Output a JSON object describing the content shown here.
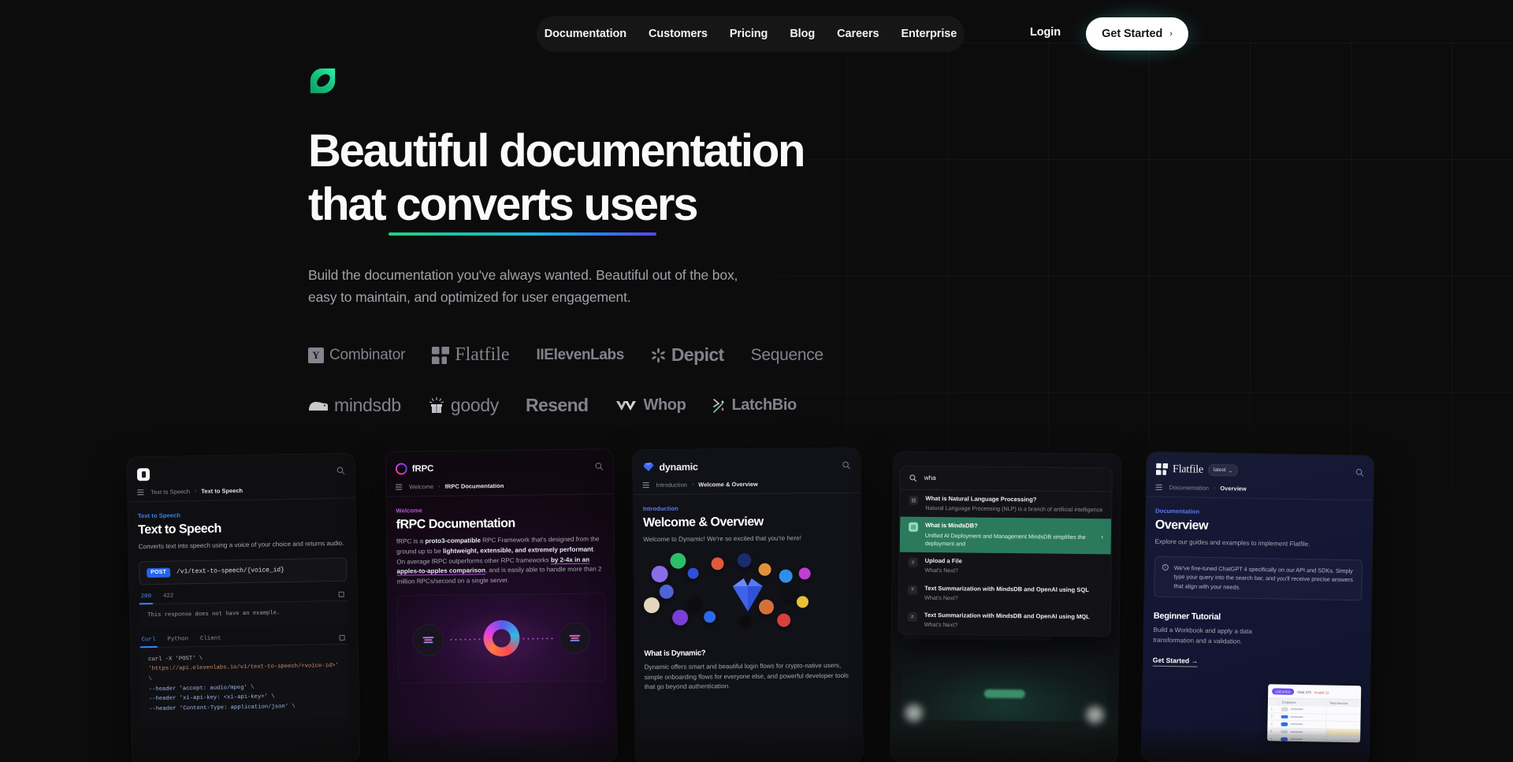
{
  "brand": {
    "logo_icon": "mintlify-leaf-logo"
  },
  "nav": {
    "items": [
      {
        "label": "Documentation"
      },
      {
        "label": "Customers"
      },
      {
        "label": "Pricing"
      },
      {
        "label": "Blog"
      },
      {
        "label": "Careers"
      },
      {
        "label": "Enterprise"
      }
    ],
    "login_label": "Login",
    "cta_label": "Get Started",
    "cta_chevron": "›"
  },
  "hero": {
    "headline_line1": "Beautiful documentation",
    "headline_line2": "that converts users",
    "subhead": "Build the documentation you've always wanted. Beautiful out of the box, easy to maintain, and optimized for user engagement.",
    "underline_gradient": [
      "#21d37d",
      "#16c6a4",
      "#18b7e0",
      "#2f7bf0",
      "#5b43ea"
    ]
  },
  "logos": {
    "row1": [
      {
        "name": "Y Combinator",
        "mark": "Y",
        "text": "Combinator"
      },
      {
        "name": "Flatfile",
        "text": "Flatfile"
      },
      {
        "name": "ElevenLabs",
        "text": "IIElevenLabs"
      },
      {
        "name": "Depict",
        "text": "Depict"
      },
      {
        "name": "Sequence",
        "text": "Sequence"
      }
    ],
    "row2": [
      {
        "name": "mindsdb",
        "text": "mindsdb"
      },
      {
        "name": "goody",
        "text": "goody"
      },
      {
        "name": "Resend",
        "text": "Resend"
      },
      {
        "name": "Whop",
        "text": "Whop"
      },
      {
        "name": "LatchBio",
        "text": "LatchBio"
      }
    ]
  },
  "showcase": {
    "card1": {
      "brand": "",
      "breadcrumb": {
        "parent": "Text to Speech",
        "sep": "›",
        "current": "Text to Speech"
      },
      "eyebrow": "Text to Speech",
      "eyebrow_color": "#3b82f6",
      "title": "Text to Speech",
      "desc": "Converts text into speech using a voice of your choice and returns audio.",
      "method": "POST",
      "path": "/v1/text-to-speech/{voice_id}",
      "resp_tabs": [
        "200",
        "422"
      ],
      "resp_active": "200",
      "resp_text": "This response does not have an example.",
      "lang_tabs": [
        "Curl",
        "Python",
        "Client"
      ],
      "lang_active": "Curl",
      "code": [
        "curl -X 'POST' \\",
        "  'https://api.elevenlabs.io/v1/text-to-speech/<voice-id>' \\",
        "  --header 'accept: audio/mpeg' \\",
        "  --header 'xi-api-key: <xi-api-key>' \\",
        "  --header 'Content-Type: application/json' \\"
      ]
    },
    "card2": {
      "brand": "fRPC",
      "breadcrumb": {
        "parent": "Welcome",
        "sep": "›",
        "current": "fRPC Documentation"
      },
      "eyebrow": "Welcome",
      "eyebrow_color": "#b45bd8",
      "title": "fRPC Documentation",
      "body_parts": [
        {
          "t": "fRPC is a ",
          "b": false
        },
        {
          "t": "proto3-compatible",
          "b": true
        },
        {
          "t": " RPC Framework that's designed from the ground up to be ",
          "b": false
        },
        {
          "t": "lightweight, extensible, and extremely performant",
          "b": true
        },
        {
          "t": ". On average fRPC outperforms other RPC frameworks ",
          "b": false
        },
        {
          "t": "by 2-4x in an apples-to-apples comparison",
          "b": true,
          "u": true
        },
        {
          "t": ", and is easily able to handle more than 2 million RPCs/second on a single server.",
          "b": false
        }
      ]
    },
    "card3": {
      "brand": "dynamic",
      "breadcrumb": {
        "parent": "Introduction",
        "sep": "›",
        "current": "Welcome & Overview"
      },
      "eyebrow": "Introduction",
      "eyebrow_color": "#5b7cf7",
      "title": "Welcome & Overview",
      "desc": "Welcome to Dynamic! We're so excited that you're here!",
      "section_title": "What is Dynamic?",
      "section_desc": "Dynamic offers smart and beautiful login flows for crypto-native users, simple onboarding flows for everyone else, and powerful developer tools that go beyond authentication."
    },
    "card4": {
      "search_query": "wha",
      "results": [
        {
          "icon": "document-icon",
          "title": "What is Natural Language Processing?",
          "subtitle": "Natural Language Processing (NLP) is a branch of artificial intelligence",
          "selected": false
        },
        {
          "icon": "document-icon",
          "title": "What is MindsDB?",
          "subtitle": "Unified AI Deployment and Management MindsDB simplifies the deployment and",
          "selected": true
        },
        {
          "icon": "hash-icon",
          "title": "Upload a File",
          "subtitle": "What's Next?",
          "selected": false
        },
        {
          "icon": "hash-icon",
          "title": "Text Summarization with MindsDB and OpenAI using SQL",
          "subtitle": "What's Next?",
          "selected": false
        },
        {
          "icon": "hash-icon",
          "title": "Text Summarization with MindsDB and OpenAI using MQL",
          "subtitle": "What's Next?",
          "selected": false
        }
      ]
    },
    "card5": {
      "brand": "Flatfile",
      "version_badge": "latest",
      "breadcrumb": {
        "parent": "Documentation",
        "sep": "›",
        "current": "Overview"
      },
      "eyebrow": "Documentation",
      "eyebrow_color": "#5b7cf7",
      "title": "Overview",
      "desc": "Explore our guides and examples to implement Flatfile.",
      "callout": "We've fine-tuned ChatGPT 4 specifically on our API and SDKs. Simply type your query into the search bar, and you'll receive precise answers that align with your needs.",
      "section_title": "Beginner Tutorial",
      "section_desc": "Build a Workbook and apply a data transformation and a validation.",
      "cta": "Get Started →",
      "workbook": {
        "pill": "CREATED",
        "stat1": "Valid 375",
        "stat2": "Invalid 12",
        "col1": "",
        "col2": "Employee",
        "col3": "Total Amount",
        "rows": [
          "1",
          "2",
          "3",
          "4",
          "5"
        ]
      }
    }
  }
}
